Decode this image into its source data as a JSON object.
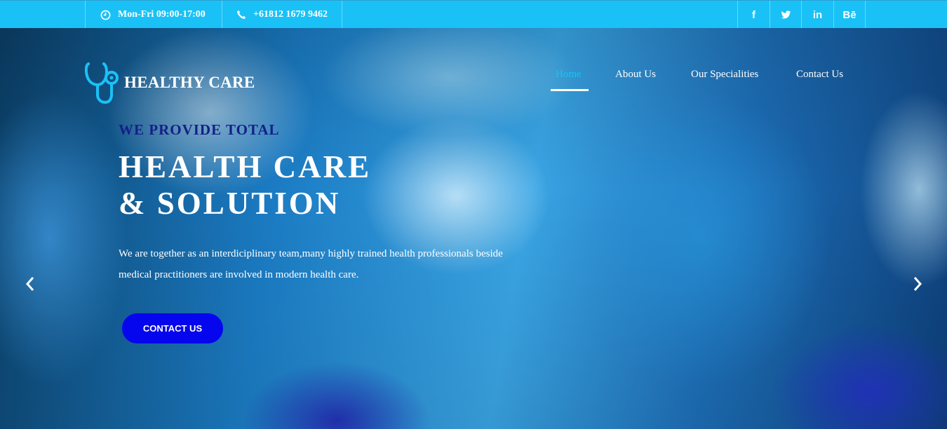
{
  "topbar": {
    "hours": "Mon-Fri 09:00-17:00",
    "phone": "+61812 1679 9462",
    "social": [
      {
        "icon": "facebook-icon",
        "label": "f"
      },
      {
        "icon": "twitter-icon",
        "label": ""
      },
      {
        "icon": "linkedin-icon",
        "label": "in"
      },
      {
        "icon": "behance-icon",
        "label": "Bē"
      }
    ],
    "background": "#1ac1f6"
  },
  "logo": {
    "text": "HEALTHY CARE",
    "icon": "stethoscope-icon",
    "icon_color": "#1ac1f6"
  },
  "nav": {
    "items": [
      {
        "label": "Home",
        "active": true
      },
      {
        "label": "About Us",
        "active": false
      },
      {
        "label": "Our Specialities",
        "active": false
      },
      {
        "label": "Contact Us",
        "active": false
      }
    ],
    "active_color": "#1ac1f6"
  },
  "hero": {
    "kicker": "WE PROVIDE TOTAL",
    "headline_line1": "HEALTH CARE",
    "headline_line2": "& SOLUTION",
    "lead": "We are together as an interdiciplinary team,many highly trained health professionals beside medical practitioners are involved in modern health care.",
    "cta_label": "CONTACT US",
    "cta_color": "#0505ee",
    "kicker_color": "#141f88"
  },
  "carousel": {
    "prev_icon": "chevron-left-icon",
    "next_icon": "chevron-right-icon"
  }
}
